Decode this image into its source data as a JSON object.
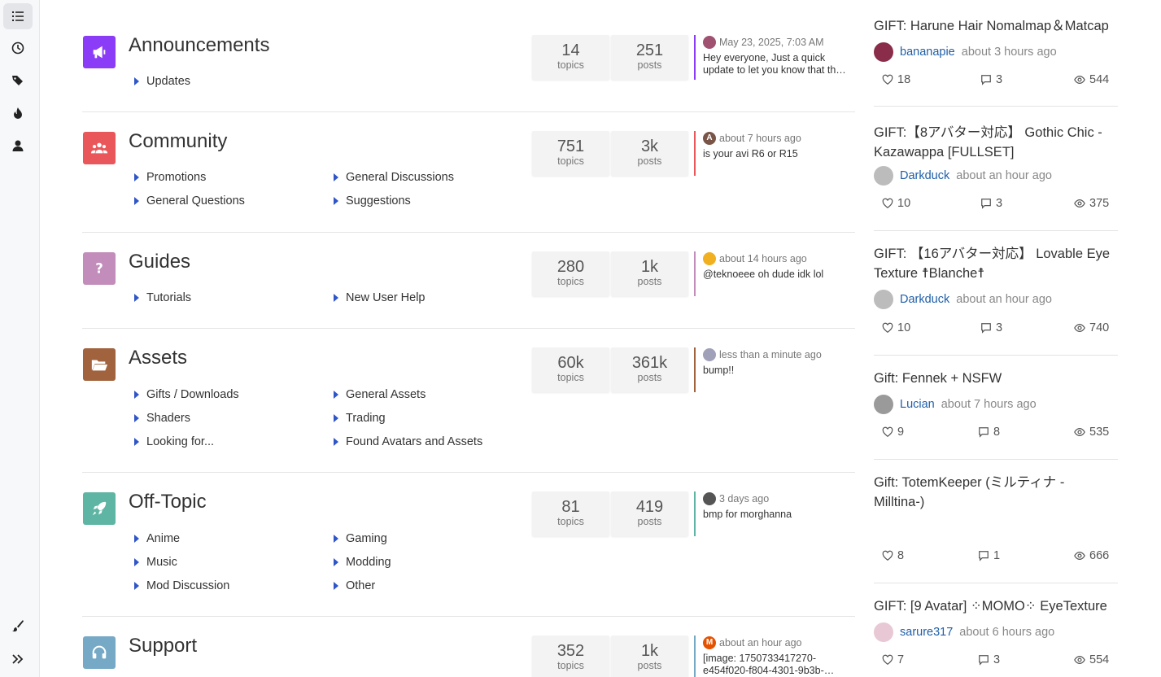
{
  "rail": {
    "items": [
      "list-icon",
      "clock-icon",
      "tags-icon",
      "fire-icon",
      "user-icon"
    ],
    "bottom": [
      "brush-icon",
      "expand-icon"
    ]
  },
  "categories": [
    {
      "name": "Announcements",
      "color": "#8b3cf6",
      "icon": "megaphone-icon",
      "subs": [
        "Updates"
      ],
      "topics": "14",
      "topics_label": "topics",
      "posts": "251",
      "posts_label": "posts",
      "last_time": "May 23, 2025, 7:03 AM",
      "last_text": "Hey everyone, Just a quick update to let you know that th…",
      "avatar_color": "#a05070"
    },
    {
      "name": "Community",
      "color": "#e9575a",
      "icon": "users-icon",
      "subs": [
        "Promotions",
        "General Discussions",
        "General Questions",
        "Suggestions"
      ],
      "topics": "751",
      "topics_label": "topics",
      "posts": "3k",
      "posts_label": "posts",
      "last_time": "about 7 hours ago",
      "last_text": "is your avi R6 or R15",
      "avatar_color": "#795548",
      "avatar_letter": "A"
    },
    {
      "name": "Guides",
      "color": "#c28dbb",
      "icon": "question-icon",
      "subs": [
        "Tutorials",
        "New User Help"
      ],
      "topics": "280",
      "topics_label": "topics",
      "posts": "1k",
      "posts_label": "posts",
      "last_time": "about 14 hours ago",
      "last_text": "@teknoeee oh dude idk lol",
      "avatar_color": "#f0b020"
    },
    {
      "name": "Assets",
      "color": "#a1633d",
      "icon": "folder-icon",
      "subs": [
        "Gifts / Downloads",
        "General Assets",
        "Shaders",
        "Trading",
        "Looking for...",
        "Found Avatars and Assets"
      ],
      "topics": "60k",
      "topics_label": "topics",
      "posts": "361k",
      "posts_label": "posts",
      "last_time": "less than a minute ago",
      "last_text": "bump!!",
      "avatar_color": "#a0a0b8"
    },
    {
      "name": "Off-Topic",
      "color": "#5fb5a3",
      "icon": "rocket-icon",
      "subs": [
        "Anime",
        "Gaming",
        "Music",
        "Modding",
        "Mod Discussion",
        "Other"
      ],
      "topics": "81",
      "topics_label": "topics",
      "posts": "419",
      "posts_label": "posts",
      "last_time": "3 days ago",
      "last_text": "bmp for morghanna",
      "avatar_color": "#555"
    },
    {
      "name": "Support",
      "color": "#75a9c5",
      "icon": "headset-icon",
      "subs": [],
      "topics": "352",
      "topics_label": "topics",
      "posts": "1k",
      "posts_label": "posts",
      "last_time": "about an hour ago",
      "last_text": "[image: 1750733417270-e454f020-f804-4301-9b3b-…",
      "avatar_color": "#e65100",
      "avatar_letter": "M"
    }
  ],
  "topics": [
    {
      "title": "GIFT: Harune Hair Nomalmap＆Matcap",
      "user": "bananapie",
      "time": "about 3 hours ago",
      "likes": "18",
      "replies": "3",
      "views": "544",
      "avatar_color": "#8a2d4a"
    },
    {
      "title": "GIFT:【8アバター対応】 Gothic Chic - Kazawappa [FULLSET]",
      "user": "Darkduck",
      "time": "about an hour ago",
      "likes": "10",
      "replies": "3",
      "views": "375",
      "avatar_color": "#bcbcbc"
    },
    {
      "title": "GIFT: 【16アバター対応】 Lovable Eye Texture ☨Blanche☨",
      "user": "Darkduck",
      "time": "about an hour ago",
      "likes": "10",
      "replies": "3",
      "views": "740",
      "avatar_color": "#bcbcbc"
    },
    {
      "title": "Gift: Fennek + NSFW",
      "user": "Lucian",
      "time": "about 7 hours ago",
      "likes": "9",
      "replies": "8",
      "views": "535",
      "avatar_color": "#9a9a9a"
    },
    {
      "title": "Gift: TotemKeeper (ミルティナ - Milltina-)",
      "user": "",
      "time": "",
      "likes": "8",
      "replies": "1",
      "views": "666",
      "avatar_color": ""
    },
    {
      "title": "GIFT: [9 Avatar] ⁘MOMO⁘ EyeTexture",
      "user": "sarure317",
      "time": "about 6 hours ago",
      "likes": "7",
      "replies": "3",
      "views": "554",
      "avatar_color": "#e8c8d4"
    }
  ]
}
